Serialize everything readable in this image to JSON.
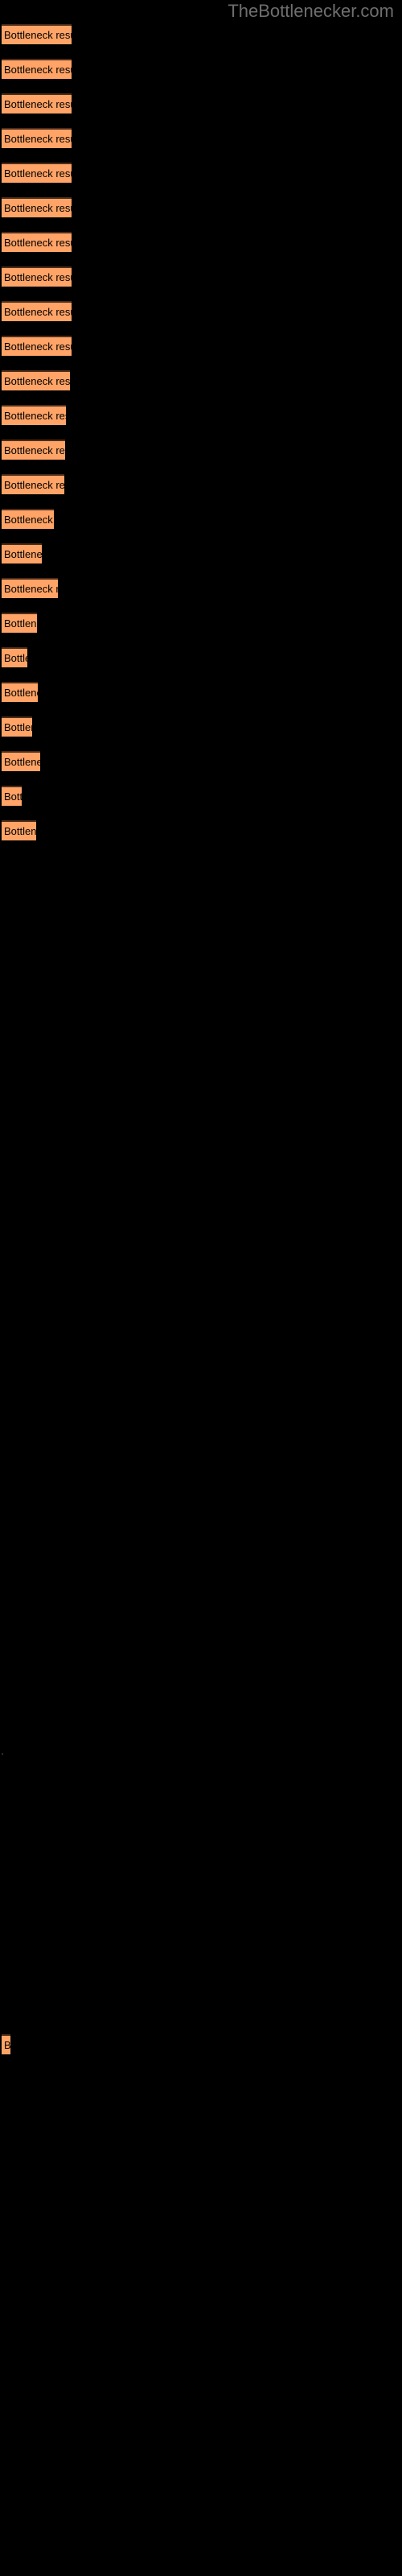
{
  "site": {
    "title": "TheBottlenecker.com",
    "title_color": "#6e6e6e"
  },
  "theme": {
    "background": "#000000",
    "bar_fill": "#ffa366",
    "bar_border_top": "#4d2d1a",
    "label_color": "#000000"
  },
  "chart_data": {
    "type": "bar",
    "orientation": "horizontal",
    "title": "TheBottlenecker.com",
    "xlabel": "",
    "ylabel": "",
    "grid": false,
    "legend": null,
    "bar_label_text": "Bottleneck result",
    "series": [
      {
        "name": "Bottleneck result",
        "values": [
          87,
          87,
          87,
          87,
          87,
          87,
          87,
          87,
          87,
          87,
          85,
          80,
          79,
          78,
          65,
          50,
          70,
          44,
          32,
          45,
          38,
          48,
          25,
          43,
          11
        ]
      }
    ],
    "bars": [
      {
        "label": "Bottleneck result",
        "width": 87
      },
      {
        "label": "Bottleneck result",
        "width": 87
      },
      {
        "label": "Bottleneck result",
        "width": 87
      },
      {
        "label": "Bottleneck result",
        "width": 87
      },
      {
        "label": "Bottleneck result",
        "width": 87
      },
      {
        "label": "Bottleneck result",
        "width": 87
      },
      {
        "label": "Bottleneck result",
        "width": 87
      },
      {
        "label": "Bottleneck result",
        "width": 87
      },
      {
        "label": "Bottleneck result",
        "width": 87
      },
      {
        "label": "Bottleneck result",
        "width": 87
      },
      {
        "label": "Bottleneck result",
        "width": 85
      },
      {
        "label": "Bottleneck result",
        "width": 80
      },
      {
        "label": "Bottleneck result",
        "width": 79
      },
      {
        "label": "Bottleneck result",
        "width": 78
      },
      {
        "label": "Bottleneck result",
        "width": 65
      },
      {
        "label": "Bottleneck result",
        "width": 50
      },
      {
        "label": "Bottleneck result",
        "width": 70
      },
      {
        "label": "Bottleneck result",
        "width": 44
      },
      {
        "label": "Bottleneck result",
        "width": 32
      },
      {
        "label": "Bottleneck result",
        "width": 45
      },
      {
        "label": "Bottleneck result",
        "width": 38
      },
      {
        "label": "Bottleneck result",
        "width": 48
      },
      {
        "label": "Bottleneck result",
        "width": 25
      },
      {
        "label": "Bottleneck result",
        "width": 43
      },
      {
        "label": "Bottleneck result",
        "width": 11
      }
    ],
    "bar_geometry": {
      "first_top": 30,
      "pitch": 43,
      "height": 25,
      "left": 2,
      "tiny_bar_top": 2527,
      "tiny_mark_top": 2178
    }
  }
}
